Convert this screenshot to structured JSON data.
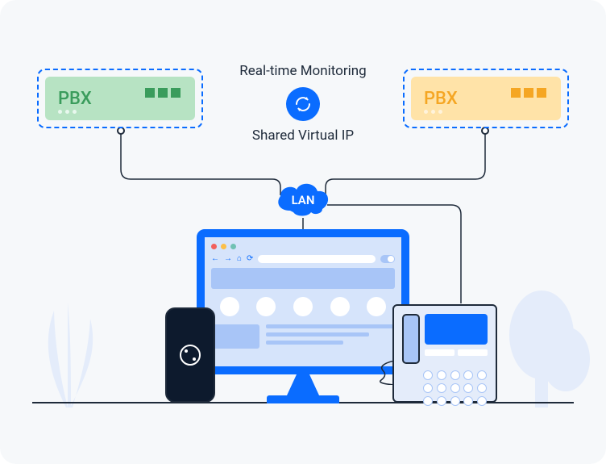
{
  "title_top": "Real-time Monitoring",
  "title_bottom": "Shared Virtual IP",
  "cloud_label": "LAN",
  "pbx_left": {
    "label": "PBX"
  },
  "pbx_right": {
    "label": "PBX"
  },
  "colors": {
    "primary": "#0a6cff",
    "pbx_green_bg": "#b7e3c3",
    "pbx_green_fg": "#3a9c5c",
    "pbx_orange_bg": "#ffe3a8",
    "pbx_orange_fg": "#f5a623",
    "dark": "#1e2a3a"
  }
}
